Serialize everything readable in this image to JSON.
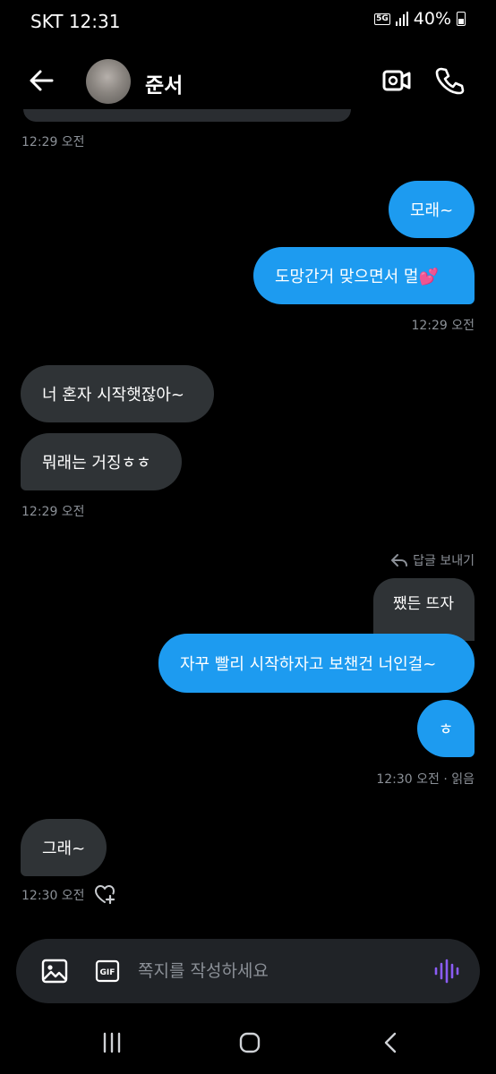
{
  "status_bar": {
    "carrier_time": "SKT 12:31",
    "network": "5G",
    "battery": "40%"
  },
  "header": {
    "contact_name": "준서"
  },
  "messages": [
    {
      "dir": "out",
      "text": "모래~"
    },
    {
      "dir": "out",
      "text": "도망간거 맞으면서 멀💕"
    },
    {
      "dir": "in",
      "text": "너 혼자 시작햇잖아~"
    },
    {
      "dir": "in",
      "text": "뭐래는 거징ㅎㅎ"
    },
    {
      "dir": "out",
      "text": "자꾸 빨리 시작하자고 보챈건 너인걸~"
    },
    {
      "dir": "out",
      "text": "ㅎ"
    },
    {
      "dir": "in",
      "text": "그래~"
    }
  ],
  "timestamps": {
    "top": "12:29 오전",
    "after_out_1": "12:29 오전",
    "after_in_1": "12:29 오전",
    "after_out_2": "12:30 오전 · 읽음",
    "after_in_2": "12:30 오전"
  },
  "reply": {
    "label": "답글 보내기",
    "quoted_text": "쨌든 뜨자"
  },
  "composer": {
    "placeholder": "쪽지를 작성하세요"
  },
  "colors": {
    "outgoing": "#1d9bf0",
    "incoming": "#2f3336",
    "voice_accent": "#8b5cf6"
  },
  "icons": [
    "back-arrow",
    "video-camera",
    "phone",
    "reply-arrow",
    "heart-plus",
    "image",
    "gif",
    "voice-wave",
    "nav-recent",
    "nav-home",
    "nav-back"
  ]
}
